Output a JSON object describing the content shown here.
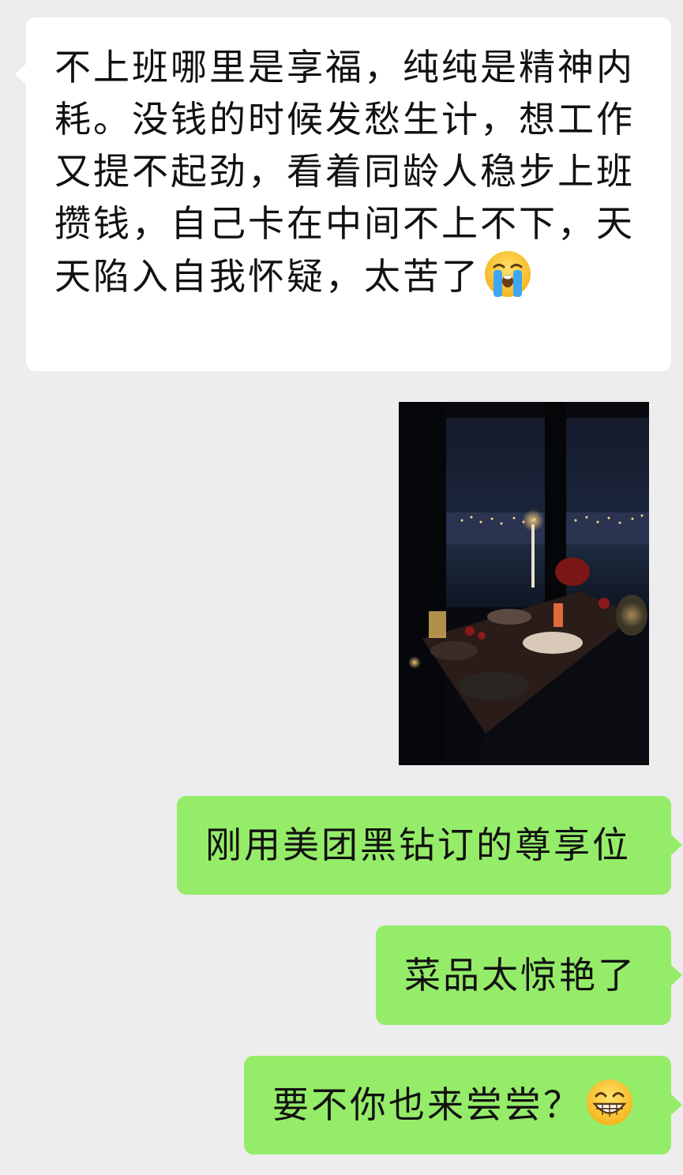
{
  "messages": [
    {
      "sender": "other",
      "text": "不上班哪里是享福，纯纯是精神内耗。没钱的时候发愁生计，想工作又提不起劲，看着同龄人稳步上班攒钱，自己卡在中间不上不下，天天陷入自我怀疑，太苦了",
      "emoji": "crying-face-emoji"
    },
    {
      "sender": "me",
      "type": "image",
      "image": "restaurant-night-dinner-photo"
    },
    {
      "sender": "me",
      "text": "刚用美团黑钻订的尊享位"
    },
    {
      "sender": "me",
      "text": "菜品太惊艳了"
    },
    {
      "sender": "me",
      "text": "要不你也来尝尝？",
      "emoji": "grinning-face-emoji"
    }
  ],
  "colors": {
    "background": "#ededed",
    "incoming_bubble": "#ffffff",
    "outgoing_bubble": "#95ec69",
    "text": "#111111"
  }
}
